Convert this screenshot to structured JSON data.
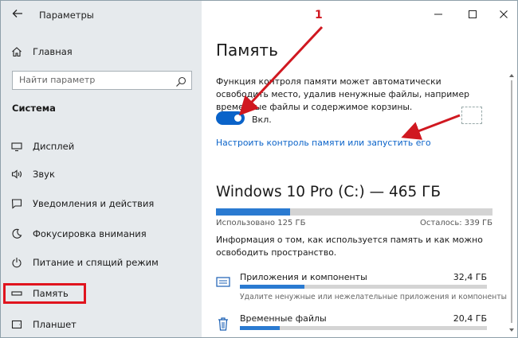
{
  "window": {
    "title": "Параметры",
    "back_icon": "back-arrow-icon",
    "controls": [
      "minimize-icon",
      "maximize-icon",
      "close-icon"
    ]
  },
  "sidebar": {
    "home": {
      "label": "Главная",
      "icon": "home-icon"
    },
    "search": {
      "placeholder": "Найти параметр",
      "icon": "search-icon"
    },
    "section_title": "Система",
    "items": [
      {
        "label": "Дисплей",
        "icon": "display-icon"
      },
      {
        "label": "Звук",
        "icon": "sound-icon"
      },
      {
        "label": "Уведомления и действия",
        "icon": "notifications-icon"
      },
      {
        "label": "Фокусировка внимания",
        "icon": "focus-assist-icon"
      },
      {
        "label": "Питание и спящий режим",
        "icon": "power-icon"
      },
      {
        "label": "Память",
        "icon": "storage-icon",
        "selected": true
      },
      {
        "label": "Планшет",
        "icon": "tablet-icon"
      }
    ]
  },
  "main": {
    "title": "Память",
    "description": "Функция контроля памяти может автоматически освободить место, удалив ненужные файлы, например временные файлы и содержимое корзины.",
    "toggle": {
      "state": "Вкл.",
      "on": true
    },
    "config_link": "Настроить контроль памяти или запустить его",
    "drive": {
      "name": "Windows 10 Pro (C:) — 465 ГБ",
      "used_label": "Использовано 125 ГБ",
      "free_label": "Осталось: 339 ГБ",
      "used_fraction": 0.269
    },
    "info": "Информация о том, как используется память и как можно освободить пространство.",
    "categories": [
      {
        "name": "Приложения и компоненты",
        "size": "32,4 ГБ",
        "fraction": 0.26,
        "description": "Удалите ненужные или нежелательные приложения и компоненты",
        "icon": "apps-icon"
      },
      {
        "name": "Временные файлы",
        "size": "20,4 ГБ",
        "fraction": 0.16,
        "description": "",
        "icon": "trash-icon"
      }
    ]
  },
  "annotation": {
    "number": "1",
    "color": "#d01820"
  },
  "colors": {
    "accent": "#0a63c9",
    "highlight": "#e0141e",
    "sidebar_bg": "#e6eaed"
  }
}
